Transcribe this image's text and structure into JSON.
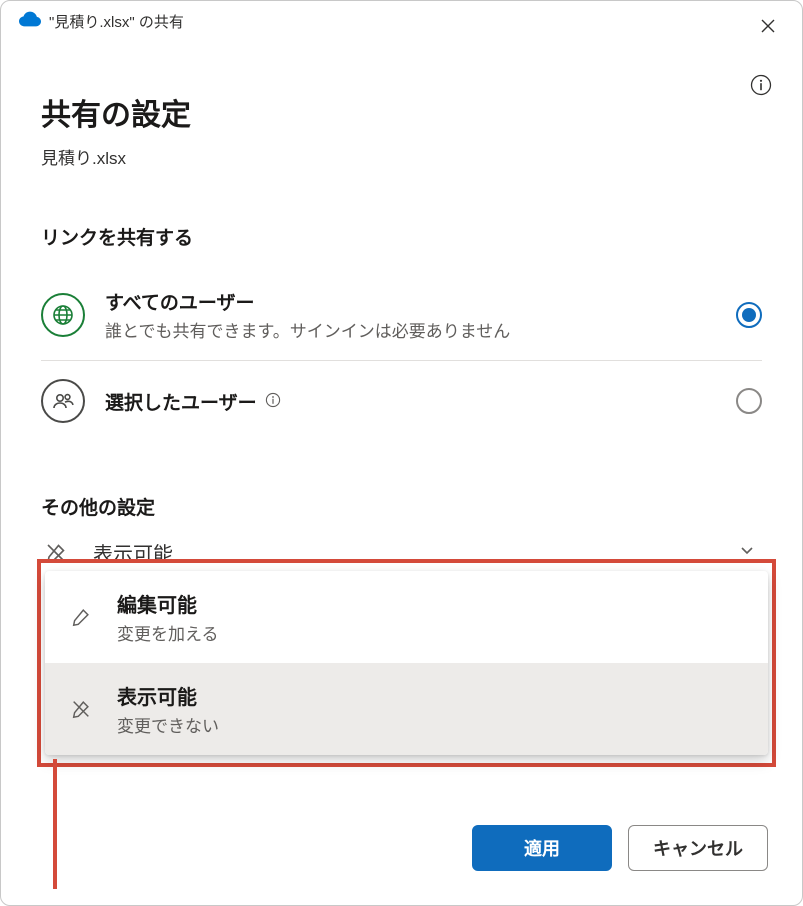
{
  "titlebar": {
    "text": "\"見積り.xlsx\" の共有"
  },
  "header": {
    "title": "共有の設定",
    "filename": "見積り.xlsx"
  },
  "section_link": {
    "title": "リンクを共有する",
    "options": [
      {
        "label": "すべてのユーザー",
        "desc": "誰とでも共有できます。サインインは必要ありません",
        "selected": true
      },
      {
        "label": "選択したユーザー",
        "desc": "",
        "selected": false
      }
    ]
  },
  "section_other": {
    "title": "その他の設定",
    "dropdown_value": "表示可能"
  },
  "permission_popup": [
    {
      "title": "編集可能",
      "desc": "変更を加える",
      "selected": false
    },
    {
      "title": "表示可能",
      "desc": "変更できない",
      "selected": true
    }
  ],
  "footer": {
    "apply": "適用",
    "cancel": "キャンセル"
  }
}
